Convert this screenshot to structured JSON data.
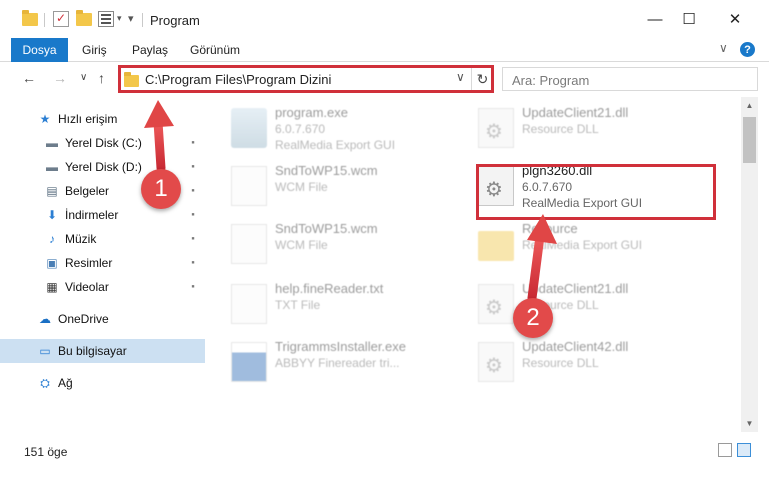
{
  "window": {
    "title": "Program",
    "minimize_glyph": "—",
    "maximize_glyph": "☐",
    "close_glyph": "✕"
  },
  "ribbon": {
    "tabs": [
      "Dosya",
      "Giriş",
      "Paylaş",
      "Görünüm"
    ],
    "expand_glyph": "∨",
    "help_glyph": "?"
  },
  "navigation": {
    "back_glyph": "←",
    "forward_glyph": "→",
    "recent_glyph": "∨",
    "up_glyph": "↑"
  },
  "address": {
    "path": "C:\\Program Files\\Program Dizini",
    "chevron_glyph": "∨",
    "refresh_glyph": "↻"
  },
  "search": {
    "placeholder": "Ara: Program",
    "icon_glyph": "⌕"
  },
  "sidebar": {
    "items": [
      {
        "label": "Hızlı erişim",
        "icon": "star-icon",
        "glyph": "★",
        "color": "#2c7fd3",
        "pinned": false
      },
      {
        "label": "Yerel Disk (C:)",
        "icon": "drive-icon",
        "glyph": "▬",
        "color": "#6d7d8c",
        "pinned": true
      },
      {
        "label": "Yerel Disk (D:)",
        "icon": "drive-icon",
        "glyph": "▬",
        "color": "#6d7d8c",
        "pinned": true
      },
      {
        "label": "Belgeler",
        "icon": "documents-icon",
        "glyph": "▤",
        "color": "#5a6e80",
        "pinned": true
      },
      {
        "label": "İndirmeler",
        "icon": "download-icon",
        "glyph": "⬇",
        "color": "#2c7fd3",
        "pinned": true
      },
      {
        "label": "Müzik",
        "icon": "music-icon",
        "glyph": "♪",
        "color": "#2c7fd3",
        "pinned": true
      },
      {
        "label": "Resimler",
        "icon": "pictures-icon",
        "glyph": "▣",
        "color": "#4a7fb5",
        "pinned": true
      },
      {
        "label": "Videolar",
        "icon": "video-icon",
        "glyph": "▦",
        "color": "#3b3b3b",
        "pinned": true
      },
      {
        "label": "OneDrive",
        "icon": "cloud-icon",
        "glyph": "☁",
        "color": "#1a6fc4",
        "pinned": false
      },
      {
        "label": "Bu bilgisayar",
        "icon": "computer-icon",
        "glyph": "▭",
        "color": "#2c7fd3",
        "pinned": false,
        "selected": true
      },
      {
        "label": "Ağ",
        "icon": "network-icon",
        "glyph": "⛭",
        "color": "#2c7fd3",
        "pinned": false
      }
    ],
    "pin_glyph": "📌"
  },
  "files": [
    {
      "name": "program.exe",
      "line2": "6.0.7.670",
      "line3": "RealMedia Export GUI",
      "icon": "exe-icon",
      "blur": true
    },
    {
      "name": "UpdateClient21.dll",
      "line2": "Resource DLL",
      "line3": "",
      "icon": "dll-icon",
      "blur": true
    },
    {
      "name": "SndToWP15.wcm",
      "line2": "WCM File",
      "line3": "",
      "icon": "file-icon",
      "blur": true
    },
    {
      "name": "plgn3260.dll",
      "line2": "6.0.7.670",
      "line3": "RealMedia Export GUI",
      "icon": "dll-icon",
      "blur": false,
      "highlight": true
    },
    {
      "name": "SndToWP15.wcm",
      "line2": "WCM File",
      "line3": "",
      "icon": "file-icon",
      "blur": true
    },
    {
      "name": "Resource",
      "line2": "RealMedia Export GUI",
      "line3": "",
      "icon": "folder-icon",
      "blur": true
    },
    {
      "name": "help.fineReader.txt",
      "line2": "TXT File",
      "line3": "",
      "icon": "file-icon",
      "blur": true
    },
    {
      "name": "UpdateClient21.dll",
      "line2": "Resource DLL",
      "line3": "",
      "icon": "dll-icon",
      "blur": true
    },
    {
      "name": "TrigrammsInstaller.exe",
      "line2": "ABBYY Finereader tri...",
      "line3": "",
      "icon": "installer-icon",
      "blur": true
    },
    {
      "name": "UpdateClient42.dll",
      "line2": "Resource DLL",
      "line3": "",
      "icon": "dll-icon",
      "blur": true
    }
  ],
  "status": {
    "item_count": "151 öge"
  },
  "annotations": {
    "callout_1": "1",
    "callout_2": "2",
    "accent": "#d0303a"
  },
  "colors": {
    "file_tab": "#1979ca",
    "selection": "#cce0f2"
  }
}
